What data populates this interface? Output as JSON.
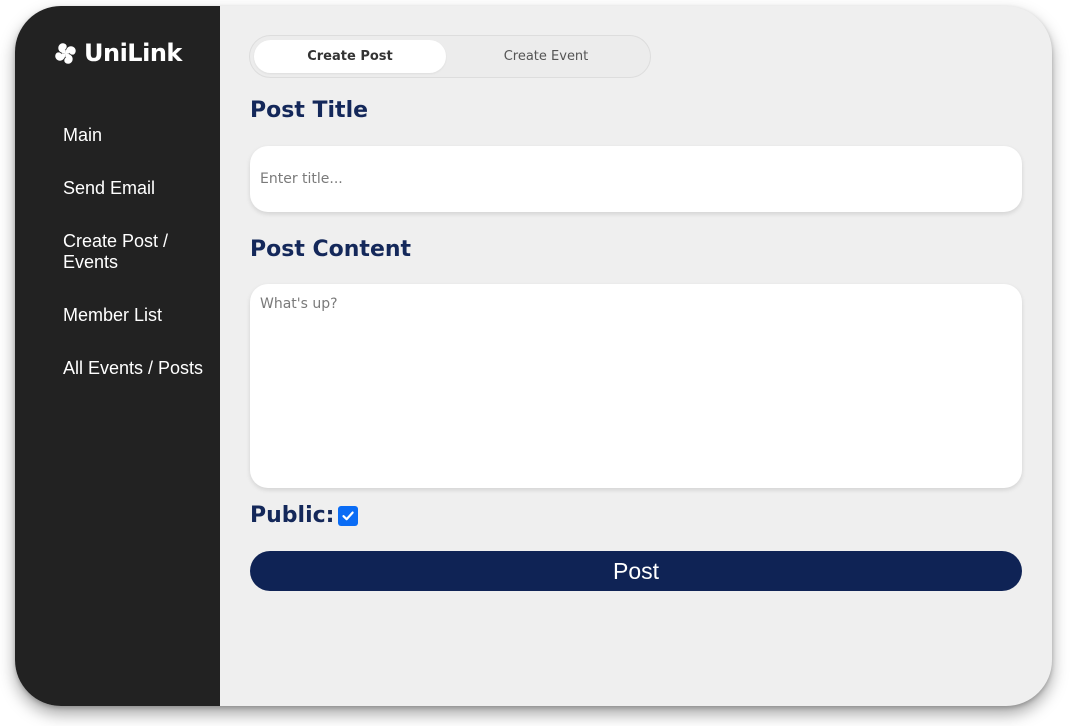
{
  "brand": {
    "name": "UniLink",
    "logo_icon": "unilink-logo-icon"
  },
  "sidebar": {
    "items": [
      {
        "label": "Main"
      },
      {
        "label": "Send Email"
      },
      {
        "label": "Create Post / Events"
      },
      {
        "label": "Member List"
      },
      {
        "label": "All Events / Posts"
      }
    ]
  },
  "tabs": {
    "create_post": "Create Post",
    "create_event": "Create Event",
    "active": "Create Post"
  },
  "form": {
    "title_heading": "Post Title",
    "title_placeholder": "Enter title...",
    "title_value": "",
    "content_heading": "Post Content",
    "content_placeholder": "What's up?",
    "content_value": "",
    "public_label": "Public:",
    "public_checked": true,
    "post_button": "Post"
  },
  "colors": {
    "sidebar_bg": "#222222",
    "main_bg": "#efefef",
    "heading": "#14285a",
    "button_bg": "#0f2355",
    "checkbox": "#0a6cf5"
  }
}
